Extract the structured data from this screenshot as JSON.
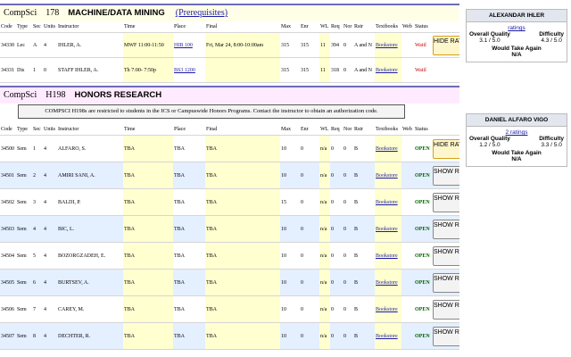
{
  "course1": {
    "dept": "CompSci",
    "num": "178",
    "title": "MACHINE/DATA MINING",
    "prereq": "(Prerequisites)"
  },
  "headers": [
    "Code",
    "Type",
    "Sec",
    "Units",
    "Instructor",
    "Time",
    "Place",
    "Final",
    "Max",
    "Enr",
    "WL",
    "Req",
    "Nor",
    "Rstr",
    "Textbooks",
    "Web",
    "Status"
  ],
  "course1_rows": [
    {
      "code": "34330",
      "type": "Lec",
      "sec": "A",
      "units": "4",
      "instructor": "IHLER, A.",
      "time": "MWF  11:00-11:50",
      "place": "HIB 100",
      "final": "Fri, Mar 24, 8:00-10:00am",
      "max": "315",
      "enr": "315",
      "wl": "11",
      "req": "394",
      "nor": "0",
      "rstr": "A and N",
      "textbooks": "Bookstore",
      "web": "",
      "status": "Waitl",
      "rating": "HIDE RATING"
    },
    {
      "code": "34331",
      "type": "Dis",
      "sec": "1",
      "units": "0",
      "instructor": "STAFF IHLER, A.",
      "time": "Th   7:00- 7:50p",
      "place": "BS3 1200",
      "final": "",
      "max": "315",
      "enr": "315",
      "wl": "11",
      "req": "318",
      "nor": "0",
      "rstr": "A and N",
      "textbooks": "Bookstore",
      "web": "",
      "status": "Waitl",
      "rating": ""
    }
  ],
  "course2": {
    "dept": "CompSci",
    "num": "H198",
    "title": "HONORS RESEARCH",
    "notice": "COMPSCI H198s are restricted to students in the ICS or Campuswide Honors Programs. Contact the instructor to obtain an authorization code."
  },
  "course2_rows": [
    {
      "code": "34500",
      "type": "Sem",
      "sec": "1",
      "units": "4",
      "instructor": "ALFARO, S.",
      "time": "TBA",
      "place": "TBA",
      "final": "TBA",
      "max": "10",
      "enr": "0",
      "wl": "n/a",
      "req": "0",
      "nor": "0",
      "rstr": "B",
      "textbooks": "Bookstore",
      "web": "",
      "status": "OPEN",
      "rating": "HIDE RATING"
    },
    {
      "code": "34501",
      "type": "Sem",
      "sec": "2",
      "units": "4",
      "instructor": "AMIRI SANI, A.",
      "time": "TBA",
      "place": "TBA",
      "final": "TBA",
      "max": "10",
      "enr": "0",
      "wl": "n/a",
      "req": "0",
      "nor": "0",
      "rstr": "B",
      "textbooks": "Bookstore",
      "web": "",
      "status": "OPEN",
      "rating": "SHOW RATING"
    },
    {
      "code": "34502",
      "type": "Sem",
      "sec": "3",
      "units": "4",
      "instructor": "BALDI, P.",
      "time": "TBA",
      "place": "TBA",
      "final": "TBA",
      "max": "15",
      "enr": "0",
      "wl": "n/a",
      "req": "0",
      "nor": "0",
      "rstr": "B",
      "textbooks": "Bookstore",
      "web": "",
      "status": "OPEN",
      "rating": "SHOW RATING"
    },
    {
      "code": "34503",
      "type": "Sem",
      "sec": "4",
      "units": "4",
      "instructor": "BIC, L.",
      "time": "TBA",
      "place": "TBA",
      "final": "TBA",
      "max": "10",
      "enr": "0",
      "wl": "n/a",
      "req": "0",
      "nor": "0",
      "rstr": "B",
      "textbooks": "Bookstore",
      "web": "",
      "status": "OPEN",
      "rating": "SHOW RATING"
    },
    {
      "code": "34504",
      "type": "Sem",
      "sec": "5",
      "units": "4",
      "instructor": "BOZORGZADEH, E.",
      "time": "TBA",
      "place": "TBA",
      "final": "TBA",
      "max": "10",
      "enr": "0",
      "wl": "n/a",
      "req": "0",
      "nor": "0",
      "rstr": "B",
      "textbooks": "Bookstore",
      "web": "",
      "status": "OPEN",
      "rating": "SHOW RATING"
    },
    {
      "code": "34505",
      "type": "Sem",
      "sec": "6",
      "units": "4",
      "instructor": "BURTSEV, A.",
      "time": "TBA",
      "place": "TBA",
      "final": "TBA",
      "max": "10",
      "enr": "0",
      "wl": "n/a",
      "req": "0",
      "nor": "0",
      "rstr": "B",
      "textbooks": "Bookstore",
      "web": "",
      "status": "OPEN",
      "rating": "SHOW RATING"
    },
    {
      "code": "34506",
      "type": "Sem",
      "sec": "7",
      "units": "4",
      "instructor": "CAREY, M.",
      "time": "TBA",
      "place": "TBA",
      "final": "TBA",
      "max": "10",
      "enr": "0",
      "wl": "n/a",
      "req": "0",
      "nor": "0",
      "rstr": "B",
      "textbooks": "Bookstore",
      "web": "",
      "status": "OPEN",
      "rating": "SHOW RATING"
    },
    {
      "code": "34507",
      "type": "Sem",
      "sec": "8",
      "units": "4",
      "instructor": "DECHTER, R.",
      "time": "TBA",
      "place": "TBA",
      "final": "TBA",
      "max": "10",
      "enr": "0",
      "wl": "n/a",
      "req": "0",
      "nor": "0",
      "rstr": "B",
      "textbooks": "Bookstore",
      "web": "",
      "status": "OPEN",
      "rating": "SHOW RATING"
    }
  ],
  "cards": [
    {
      "name": "ALEXANDAR IHLER",
      "count": "ratings",
      "quality_label": "Overall Quality",
      "quality": "3.1 / 5.0",
      "difficulty_label": "Difficulty",
      "difficulty": "4.3 / 5.0",
      "again_label": "Would Take Again",
      "again": "N/A"
    },
    {
      "name": "DANIEL ALFARO VIGO",
      "count": "2 ratings",
      "quality_label": "Overall Quality",
      "quality": "1.2 / 5.0",
      "difficulty_label": "Difficulty",
      "difficulty": "3.3 / 5.0",
      "again_label": "Would Take Again",
      "again": "N/A"
    }
  ]
}
